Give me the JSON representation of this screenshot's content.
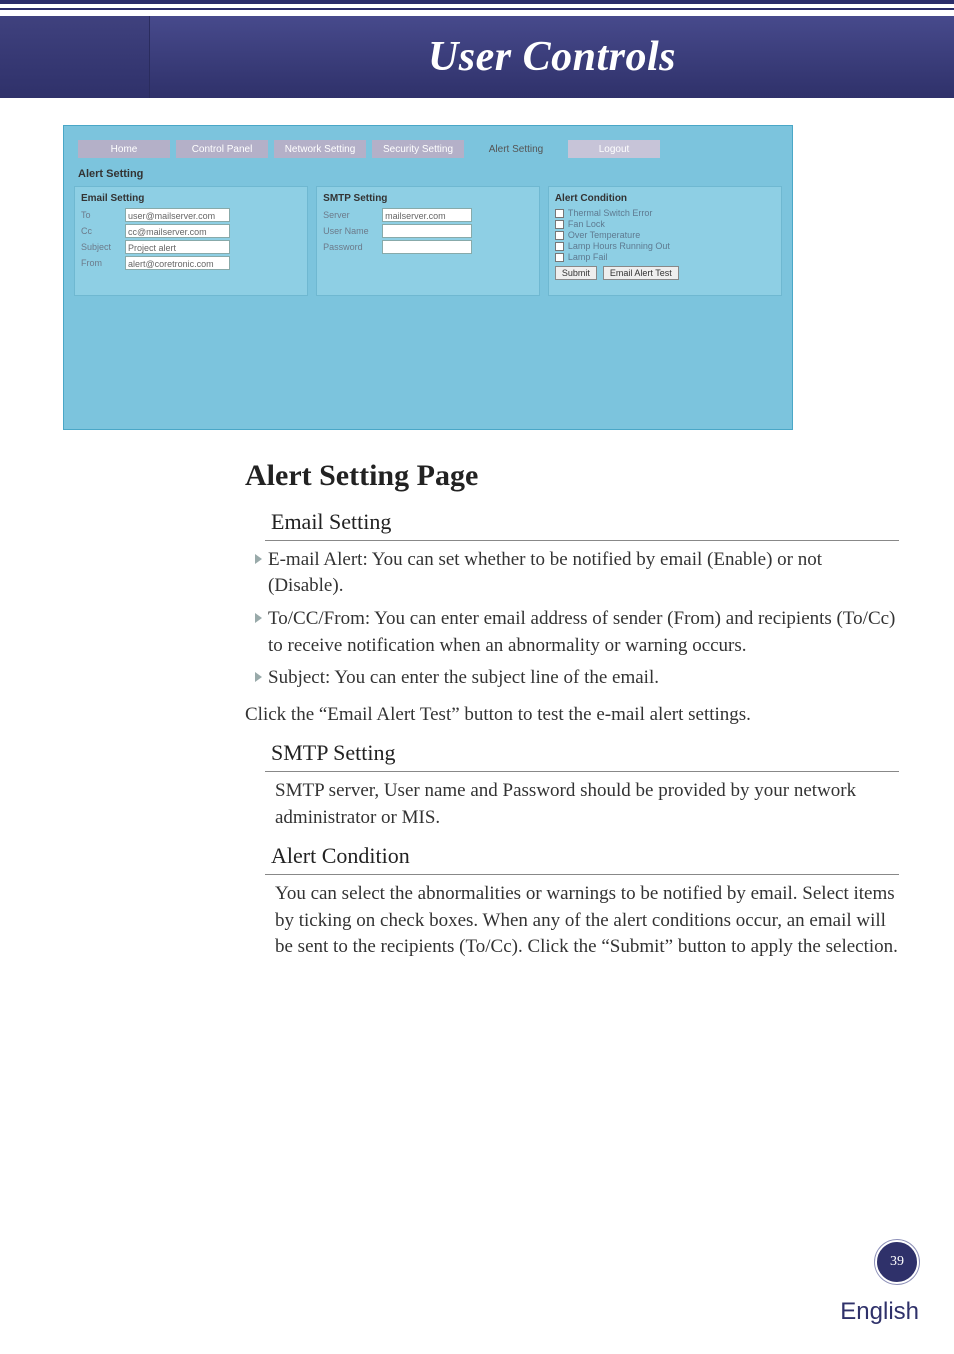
{
  "header": {
    "title": "User Controls"
  },
  "screenshot": {
    "tabs": [
      "Home",
      "Control Panel",
      "Network Setting",
      "Security Setting",
      "Alert Setting",
      "Logout"
    ],
    "section": "Alert Setting",
    "email": {
      "heading": "Email Setting",
      "to_label": "To",
      "to_value": "user@mailserver.com",
      "cc_label": "Cc",
      "cc_value": "cc@mailserver.com",
      "subject_label": "Subject",
      "subject_value": "Project alert",
      "from_label": "From",
      "from_value": "alert@coretronic.com"
    },
    "smtp": {
      "heading": "SMTP Setting",
      "server_label": "Server",
      "server_value": "mailserver.com",
      "user_label": "User Name",
      "user_value": "",
      "pass_label": "Password",
      "pass_value": ""
    },
    "alert": {
      "heading": "Alert Condition",
      "c1": "Thermal Switch Error",
      "c2": "Fan Lock",
      "c3": "Over Temperature",
      "c4": "Lamp Hours Running Out",
      "c5": "Lamp Fail",
      "submit": "Submit",
      "test": "Email Alert Test"
    }
  },
  "doc": {
    "h1": "Alert Setting Page",
    "sec1_h": "Email Setting",
    "sec1_b1": "E-mail Alert: You can set whether to be notified by email (Enable) or not (Disable).",
    "sec1_b2": "To/CC/From: You can enter email address of sender (From) and recipients (To/Cc) to receive notification when an abnormality or warning occurs.",
    "sec1_b3": "Subject: You can enter the subject line of the email.",
    "sec1_p": "Click the “Email Alert Test” button to test the e-mail alert settings.",
    "sec2_h": "SMTP Setting",
    "sec2_p": "SMTP server, User name and Password should be provided by your network administrator or MIS.",
    "sec3_h": "Alert Condition",
    "sec3_p": "You can select the abnormalities or warnings to be notified by email. Select items by ticking on check boxes. When any of the alert conditions occur, an email will be sent to the recipients (To/Cc). Click the “Submit” button to apply the selection."
  },
  "footer": {
    "page": "39",
    "lang": "English"
  }
}
